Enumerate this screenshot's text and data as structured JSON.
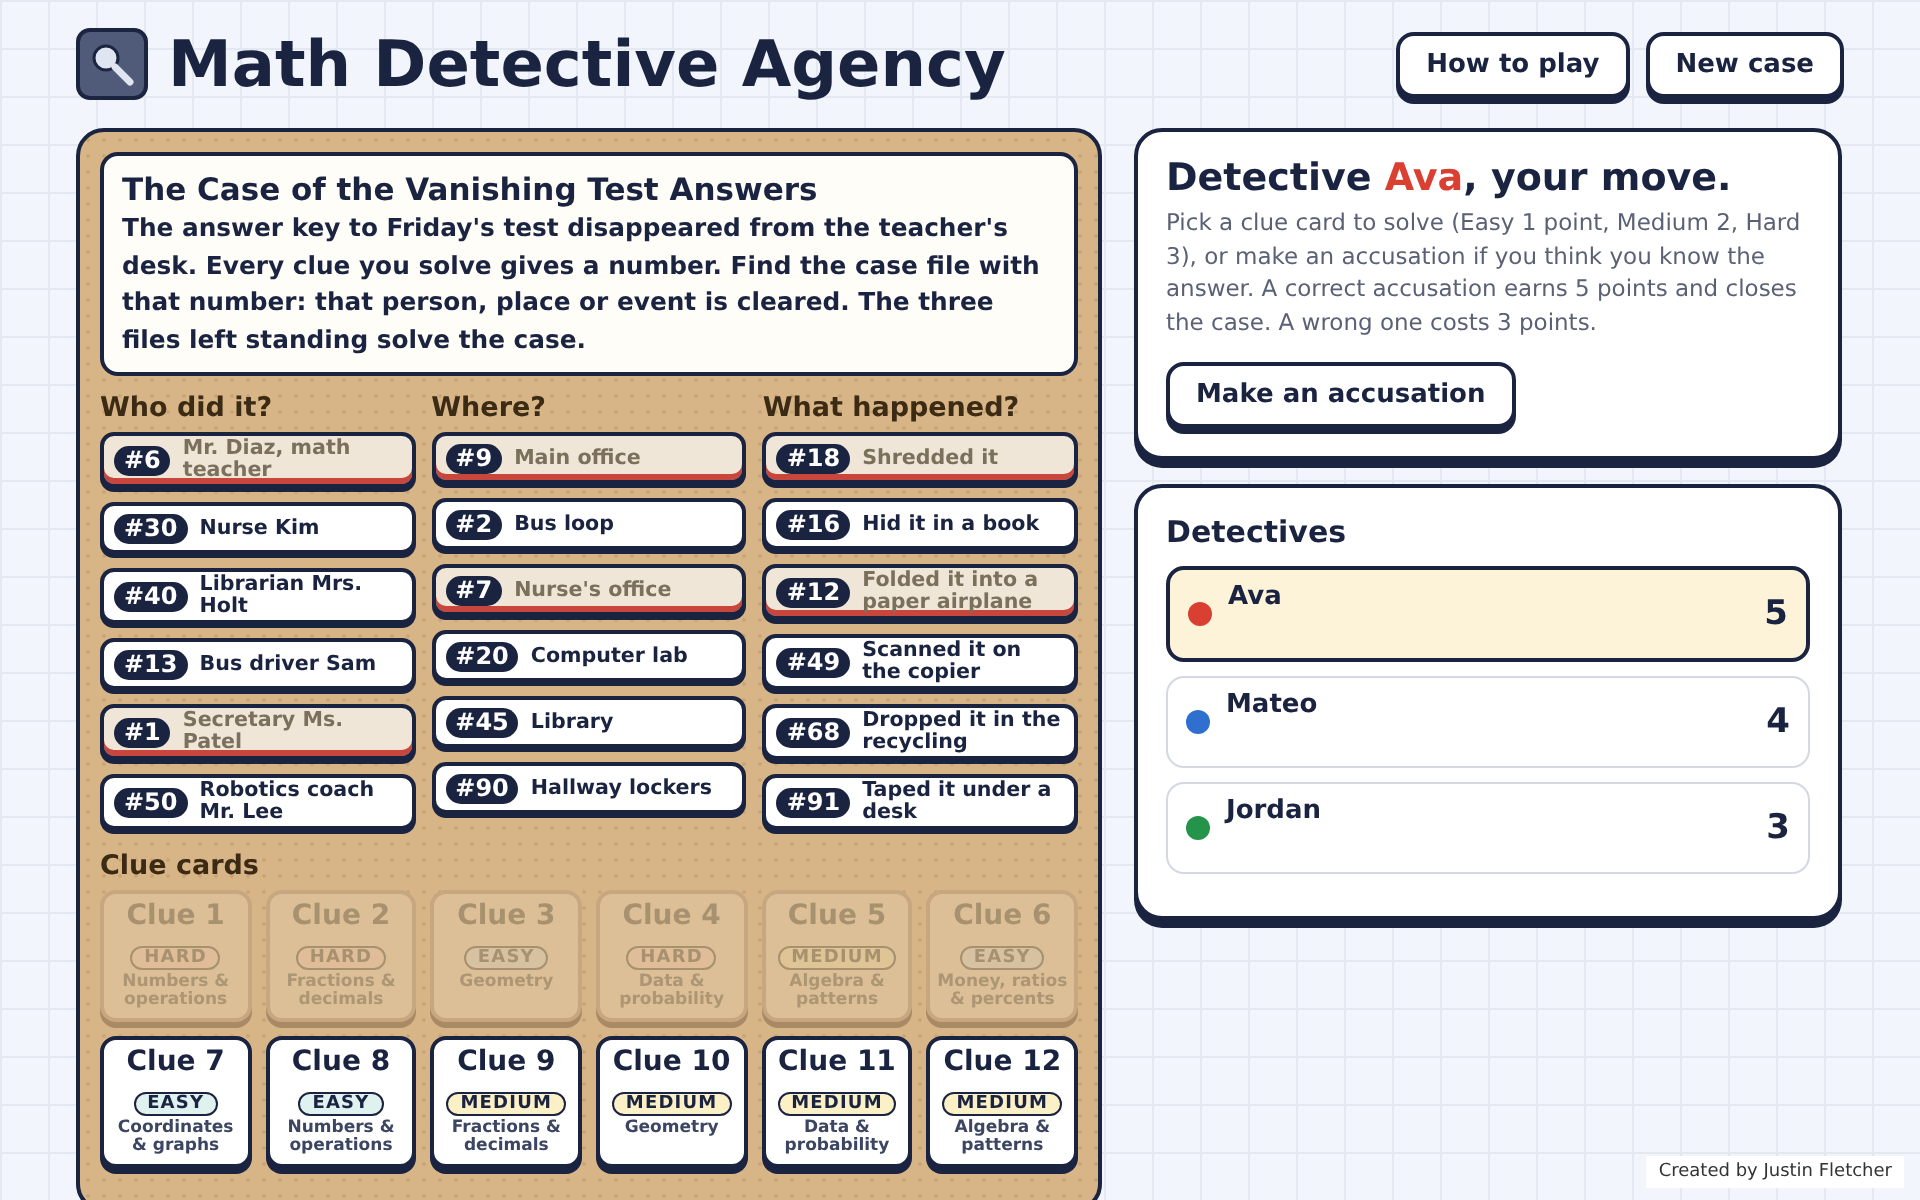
{
  "header": {
    "title": "Math Detective Agency",
    "buttons": [
      "How to play",
      "New case"
    ]
  },
  "case": {
    "title": "The Case of the Vanishing Test Answers",
    "text": "The answer key to Friday's test disappeared from the teacher's desk. Every clue you solve gives a number. Find the case file with that number: that person, place or event is cleared. The three files left standing solve the case."
  },
  "columns": [
    {
      "heading": "Who did it?",
      "files": [
        {
          "number": "#6",
          "label": "Mr. Diaz, math teacher",
          "cleared": true
        },
        {
          "number": "#30",
          "label": "Nurse Kim",
          "cleared": false
        },
        {
          "number": "#40",
          "label": "Librarian Mrs. Holt",
          "cleared": false
        },
        {
          "number": "#13",
          "label": "Bus driver Sam",
          "cleared": false
        },
        {
          "number": "#1",
          "label": "Secretary Ms. Patel",
          "cleared": true
        },
        {
          "number": "#50",
          "label": "Robotics coach Mr. Lee",
          "cleared": false
        }
      ]
    },
    {
      "heading": "Where?",
      "files": [
        {
          "number": "#9",
          "label": "Main office",
          "cleared": true
        },
        {
          "number": "#2",
          "label": "Bus loop",
          "cleared": false
        },
        {
          "number": "#7",
          "label": "Nurse's office",
          "cleared": true
        },
        {
          "number": "#20",
          "label": "Computer lab",
          "cleared": false
        },
        {
          "number": "#45",
          "label": "Library",
          "cleared": false
        },
        {
          "number": "#90",
          "label": "Hallway lockers",
          "cleared": false
        }
      ]
    },
    {
      "heading": "What happened?",
      "files": [
        {
          "number": "#18",
          "label": "Shredded it",
          "cleared": true
        },
        {
          "number": "#16",
          "label": "Hid it in a book",
          "cleared": false
        },
        {
          "number": "#12",
          "label": "Folded it into a paper airplane",
          "cleared": true
        },
        {
          "number": "#49",
          "label": "Scanned it on the copier",
          "cleared": false
        },
        {
          "number": "#68",
          "label": "Dropped it in the recycling",
          "cleared": false
        },
        {
          "number": "#91",
          "label": "Taped it under a desk",
          "cleared": false
        }
      ]
    }
  ],
  "clues": {
    "heading": "Clue cards",
    "cards": [
      {
        "title": "Clue 1",
        "difficulty": "HARD",
        "kind": "hard",
        "topic": "Numbers & operations",
        "used": true
      },
      {
        "title": "Clue 2",
        "difficulty": "HARD",
        "kind": "hard",
        "topic": "Fractions & decimals",
        "used": true
      },
      {
        "title": "Clue 3",
        "difficulty": "EASY",
        "kind": "easy",
        "topic": "Geometry",
        "used": true
      },
      {
        "title": "Clue 4",
        "difficulty": "HARD",
        "kind": "hard",
        "topic": "Data & probability",
        "used": true
      },
      {
        "title": "Clue 5",
        "difficulty": "MEDIUM",
        "kind": "medium",
        "topic": "Algebra & patterns",
        "used": true
      },
      {
        "title": "Clue 6",
        "difficulty": "EASY",
        "kind": "easy",
        "topic": "Money, ratios & percents",
        "used": true
      },
      {
        "title": "Clue 7",
        "difficulty": "EASY",
        "kind": "easy",
        "topic": "Coordinates & graphs",
        "used": false
      },
      {
        "title": "Clue 8",
        "difficulty": "EASY",
        "kind": "easy",
        "topic": "Numbers & operations",
        "used": false
      },
      {
        "title": "Clue 9",
        "difficulty": "MEDIUM",
        "kind": "medium",
        "topic": "Fractions & decimals",
        "used": false
      },
      {
        "title": "Clue 10",
        "difficulty": "MEDIUM",
        "kind": "medium",
        "topic": "Geometry",
        "used": false
      },
      {
        "title": "Clue 11",
        "difficulty": "MEDIUM",
        "kind": "medium",
        "topic": "Data & probability",
        "used": false
      },
      {
        "title": "Clue 12",
        "difficulty": "MEDIUM",
        "kind": "medium",
        "topic": "Algebra & patterns",
        "used": false
      }
    ]
  },
  "turn": {
    "before": "Detective",
    "name": "Ava",
    "after": ", your move.",
    "text": "Pick a clue card to solve (Easy 1 point, Medium 2, Hard 3), or make an accusation if you think you know the answer. A correct accusation earns 5 points and closes the case. A wrong one costs 3 points.",
    "button": "Make an accusation"
  },
  "detectives": {
    "heading": "Detectives",
    "players": [
      {
        "name": "Ava",
        "score": "5",
        "color": "#d94032",
        "selected": true
      },
      {
        "name": "Mateo",
        "score": "4",
        "color": "#2f6fd0",
        "selected": false
      },
      {
        "name": "Jordan",
        "score": "3",
        "color": "#23944a",
        "selected": false
      }
    ]
  },
  "credit": "Created by Justin Fletcher"
}
